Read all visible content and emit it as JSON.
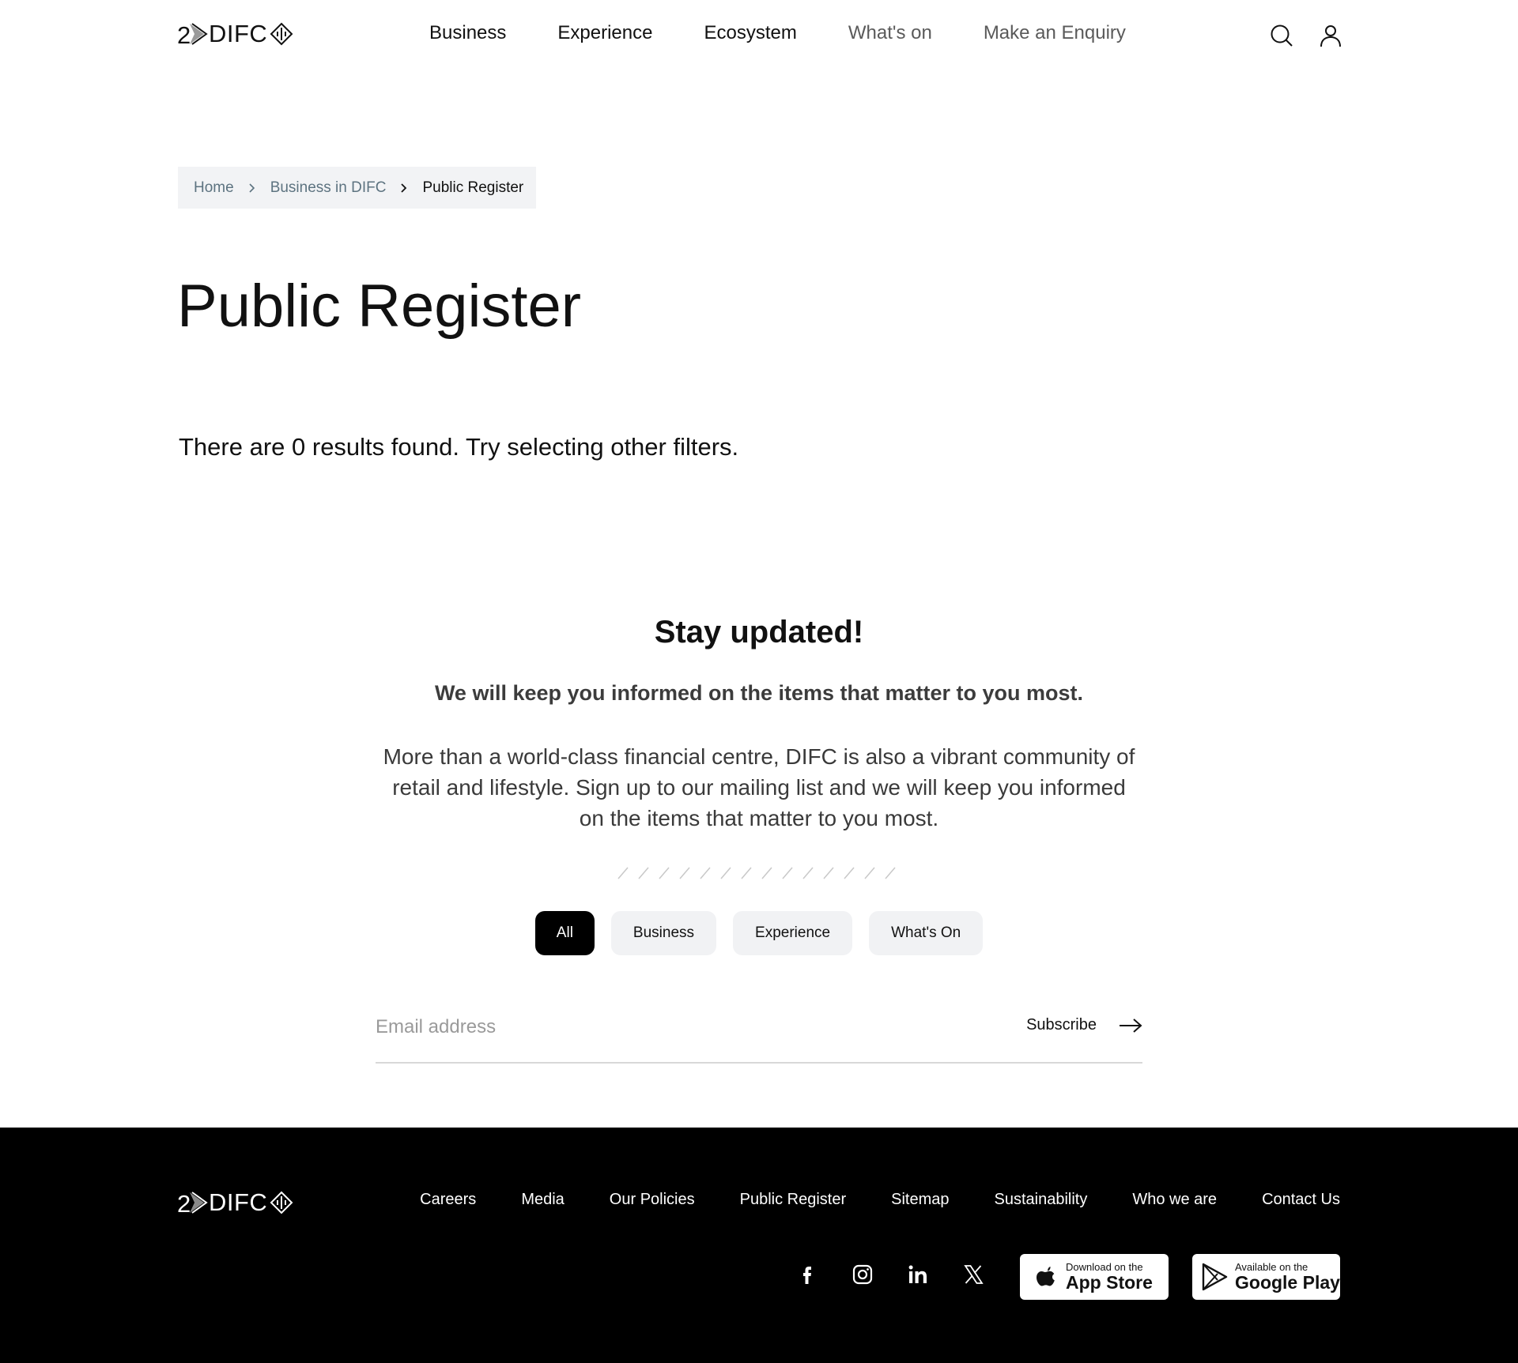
{
  "header": {
    "logo_text": "DIFC",
    "nav": [
      {
        "label": "Business"
      },
      {
        "label": "Experience"
      },
      {
        "label": "Ecosystem"
      },
      {
        "label": "What's on"
      },
      {
        "label": "Make an Enquiry"
      }
    ],
    "icons": [
      "search-icon",
      "user-icon"
    ]
  },
  "breadcrumb": {
    "items": [
      "Home",
      "Business in DIFC"
    ],
    "current": "Public Register"
  },
  "page": {
    "title": "Public Register",
    "results_text": "There are 0 results found. Try selecting other filters."
  },
  "newsletter": {
    "title": "Stay updated!",
    "subtitle": "We will keep you informed on the items that matter to you most.",
    "body": "More than a world-class financial centre, DIFC is also a vibrant community of retail and lifestyle. Sign up to our mailing list and we will keep you informed on the items that matter to you most.",
    "filters": [
      "All",
      "Business",
      "Experience",
      "What's On"
    ],
    "active_filter": "All",
    "email_placeholder": "Email address",
    "subscribe_label": "Subscribe"
  },
  "footer": {
    "logo_text": "DIFC",
    "links": [
      "Careers",
      "Media",
      "Our Policies",
      "Public Register",
      "Sitemap",
      "Sustainability",
      "Who we are",
      "Contact Us"
    ],
    "social": [
      "facebook-icon",
      "instagram-icon",
      "linkedin-icon",
      "x-icon"
    ],
    "app_store": {
      "small": "Download on the",
      "big": "App Store"
    },
    "google_play": {
      "small": "Available on the",
      "big": "Google Play"
    }
  },
  "colors": {
    "text": "#111111",
    "breadcrumb_bg": "#f2f3f5",
    "breadcrumb_link": "#5d7380",
    "chip_bg": "#f1f2f4",
    "chip_active_bg": "#000000",
    "footer_bg": "#000000"
  }
}
